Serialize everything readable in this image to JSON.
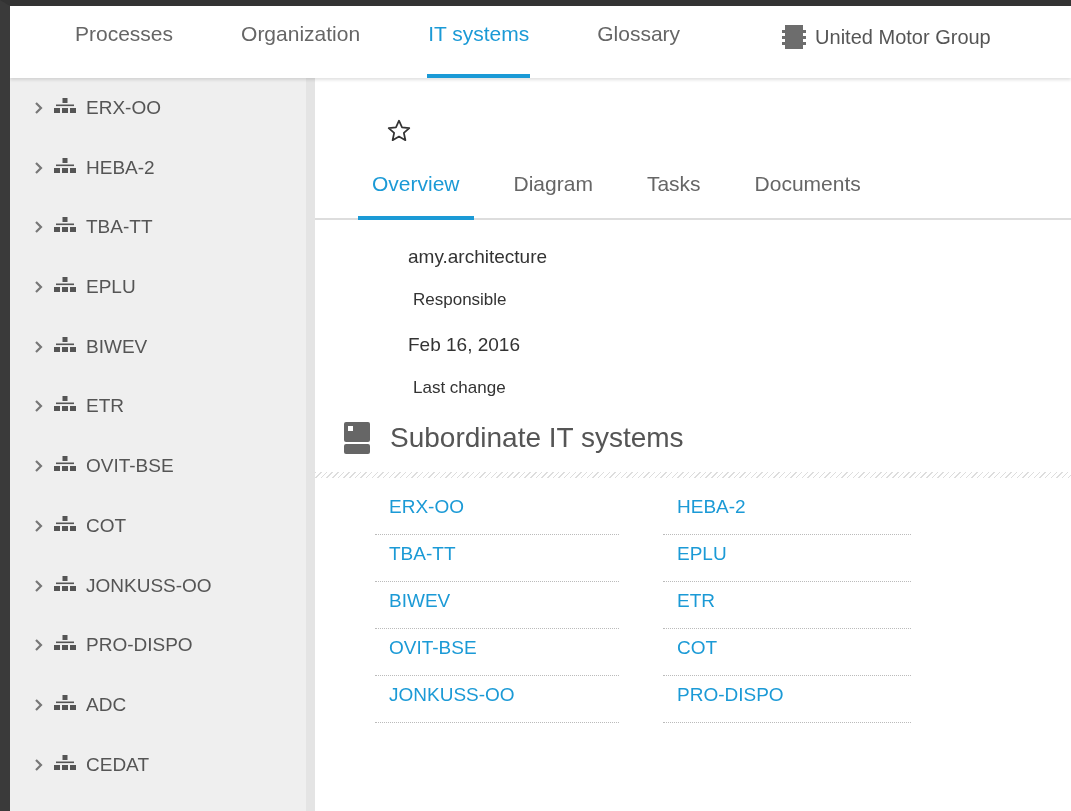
{
  "nav": {
    "tabs": [
      {
        "label": "Processes",
        "selected": false
      },
      {
        "label": "Organization",
        "selected": false
      },
      {
        "label": "IT systems",
        "selected": true
      },
      {
        "label": "Glossary",
        "selected": false
      }
    ],
    "organization": "United Motor Group"
  },
  "sidebar": {
    "items": [
      {
        "label": "ERX-OO",
        "expanded": false
      },
      {
        "label": "HEBA-2",
        "expanded": false
      },
      {
        "label": "TBA-TT",
        "expanded": false
      },
      {
        "label": "EPLU",
        "expanded": false
      },
      {
        "label": "BIWEV",
        "expanded": false
      },
      {
        "label": "ETR",
        "expanded": false
      },
      {
        "label": "OVIT-BSE",
        "expanded": false
      },
      {
        "label": "COT",
        "expanded": false
      },
      {
        "label": "JONKUSS-OO",
        "expanded": false
      },
      {
        "label": "PRO-DISPO",
        "expanded": false
      },
      {
        "label": "ADC",
        "expanded": false
      },
      {
        "label": "CEDAT",
        "expanded": false
      }
    ]
  },
  "detail": {
    "favorite": false,
    "tabs": [
      {
        "label": "Overview",
        "selected": true
      },
      {
        "label": "Diagram",
        "selected": false
      },
      {
        "label": "Tasks",
        "selected": false
      },
      {
        "label": "Documents",
        "selected": false
      }
    ],
    "fields": [
      {
        "value": "amy.architecture",
        "label": "Responsible"
      },
      {
        "value": "Feb 16, 2016",
        "label": "Last change"
      }
    ],
    "section_title": "Subordinate IT systems",
    "links": [
      "ERX-OO",
      "HEBA-2",
      "TBA-TT",
      "EPLU",
      "BIWEV",
      "ETR",
      "OVIT-BSE",
      "COT",
      "JONKUSS-OO",
      "PRO-DISPO"
    ]
  }
}
